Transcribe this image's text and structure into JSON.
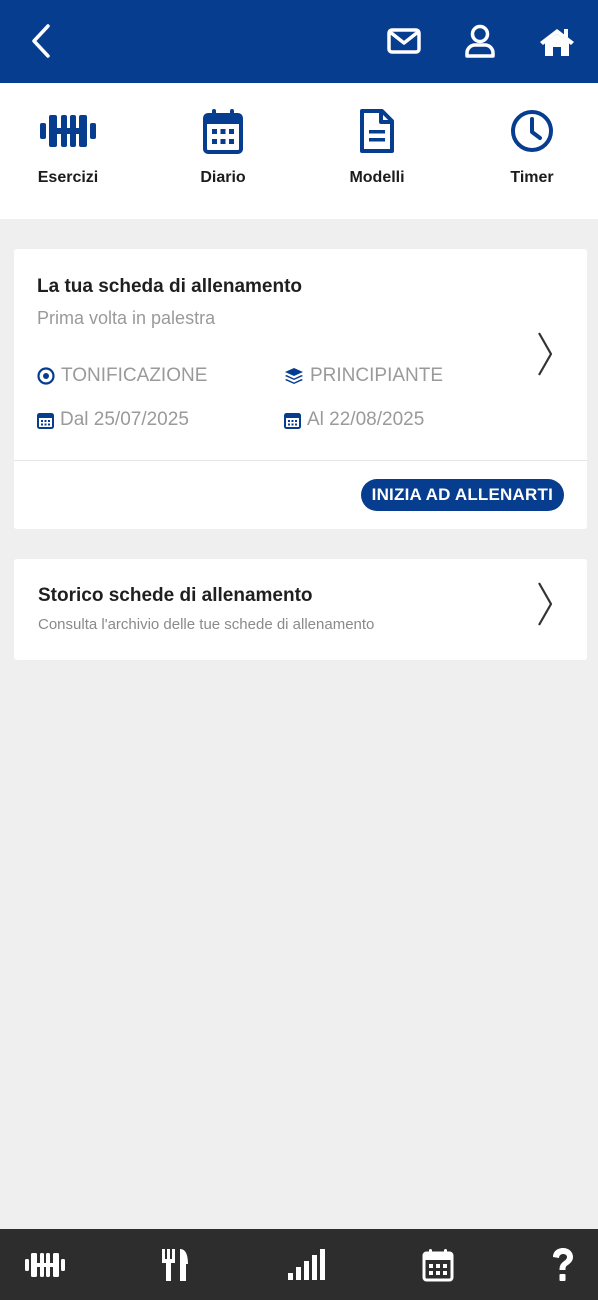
{
  "header": {
    "back_icon": "chevron-left-icon",
    "mail_icon": "envelope-icon",
    "profile_icon": "user-icon",
    "home_icon": "home-icon",
    "bg_color": "#073d8f"
  },
  "quick_nav": [
    {
      "label": "Esercizi",
      "icon": "dumbbell-icon"
    },
    {
      "label": "Diario",
      "icon": "calendar-icon"
    },
    {
      "label": "Modelli",
      "icon": "document-icon"
    },
    {
      "label": "Timer",
      "icon": "clock-icon"
    }
  ],
  "workout_card": {
    "title": "La tua scheda di allenamento",
    "subtitle": "Prima volta in palestra",
    "goal": "TONIFICAZIONE",
    "level": "PRINCIPIANTE",
    "start_date": "Dal 25/07/2025",
    "end_date": "Al 22/08/2025",
    "start_button": "INIZIA AD ALLENARTI"
  },
  "history_card": {
    "title": "Storico schede di allenamento",
    "subtitle": "Consulta l'archivio delle tue schede di allenamento"
  },
  "bottom_nav": [
    {
      "icon": "dumbbell-icon"
    },
    {
      "icon": "fork-knife-icon"
    },
    {
      "icon": "signal-bars-icon"
    },
    {
      "icon": "calendar-icon"
    },
    {
      "icon": "question-icon"
    }
  ],
  "colors": {
    "primary": "#073d8f",
    "bottom_bar": "#2d2d2d",
    "background": "#efefef"
  }
}
